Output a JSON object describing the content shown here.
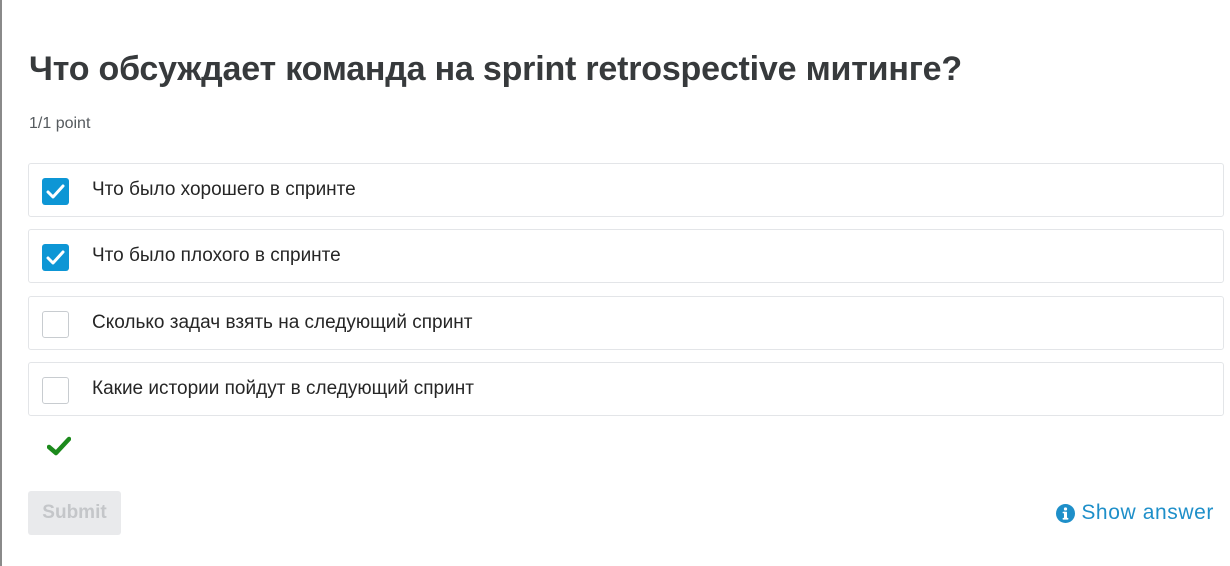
{
  "question": {
    "title": "Что обсуждает команда на sprint retrospective митинге?",
    "points": "1/1 point"
  },
  "options": [
    {
      "label": "Что было хорошего в спринте",
      "checked": true
    },
    {
      "label": "Что было плохого в спринте",
      "checked": true
    },
    {
      "label": "Сколько задач взять на следующий спринт",
      "checked": false
    },
    {
      "label": "Какие истории пойдут в следующий спринт",
      "checked": false
    }
  ],
  "result": {
    "icon": "checkmark-icon",
    "status": "correct",
    "color": "#1c8a1c"
  },
  "actions": {
    "submit_label": "Submit",
    "submit_disabled": true,
    "show_answer_label": "Show answer",
    "show_answer_icon": "info-icon"
  },
  "colors": {
    "accent": "#0d96d5",
    "link": "#1e8fc9",
    "success": "#1c8a1c",
    "title_text": "#373a3c"
  }
}
